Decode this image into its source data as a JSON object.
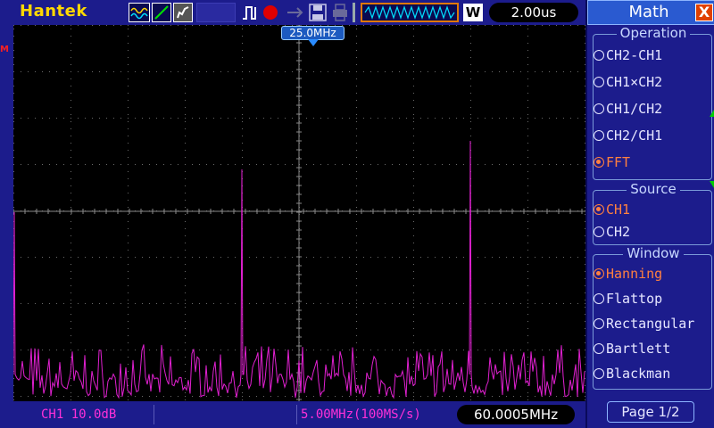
{
  "brand": "Hantek",
  "topbar": {
    "w_label": "W",
    "timebase": "2.00us",
    "icons": [
      "waveform-icon",
      "slope-icon",
      "persistence-icon",
      "pulse-trigger-icon",
      "record-icon",
      "arrow-icon",
      "save-icon",
      "print-icon",
      "timebase-icon"
    ]
  },
  "screen": {
    "m_marker": "M",
    "freq_marker": "25.0MHz"
  },
  "status": {
    "ch1": "CH1 10.0dB",
    "span": "5.00MHz(100MS/s)",
    "center": "60.0005MHz"
  },
  "menu": {
    "title": "Math",
    "close": "X",
    "operation_label": "Operation",
    "operation_options": [
      "CH2-CH1",
      "CH1×CH2",
      "CH1/CH2",
      "CH2/CH1",
      "FFT"
    ],
    "operation_selected": 4,
    "source_label": "Source",
    "source_options": [
      "CH1",
      "CH2"
    ],
    "source_selected": 0,
    "window_label": "Window",
    "window_options": [
      "Hanning",
      "Flattop",
      "Rectangular",
      "Bartlett",
      "Blackman"
    ],
    "window_selected": 0,
    "page": "Page 1/2"
  },
  "colors": {
    "trace": "#e020d0",
    "grid": "#6a6a6a",
    "frame": "#1c1c8c",
    "selected": "#ff8040"
  }
}
